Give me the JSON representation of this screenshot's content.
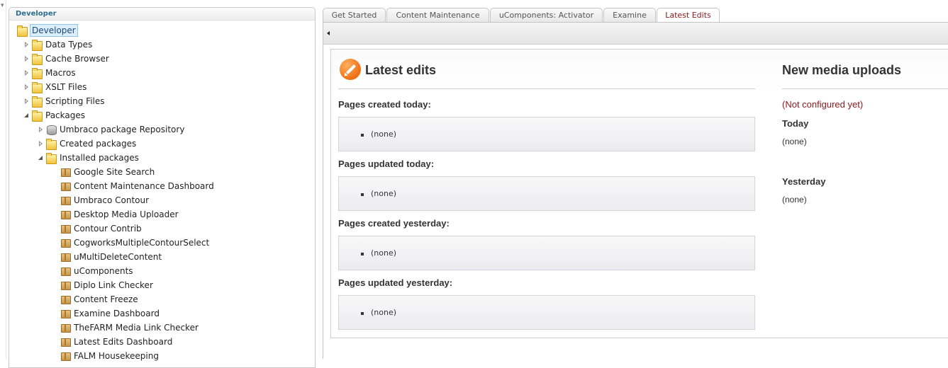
{
  "tree": {
    "header": "Developer",
    "items": [
      {
        "label": "Developer",
        "icon": "folder-icon",
        "selected": true
      },
      {
        "label": "Data Types",
        "icon": "folder-icon"
      },
      {
        "label": "Cache Browser",
        "icon": "folder-icon"
      },
      {
        "label": "Macros",
        "icon": "folder-icon"
      },
      {
        "label": "XSLT Files",
        "icon": "folder-icon"
      },
      {
        "label": "Scripting Files",
        "icon": "folder-icon"
      },
      {
        "label": "Packages",
        "icon": "folder-icon"
      },
      {
        "label": "Umbraco package Repository",
        "icon": "database-icon"
      },
      {
        "label": "Created packages",
        "icon": "folder-icon"
      },
      {
        "label": "Installed packages",
        "icon": "folder-icon"
      },
      {
        "label": "Google Site Search",
        "icon": "package-icon"
      },
      {
        "label": "Content Maintenance Dashboard",
        "icon": "package-icon"
      },
      {
        "label": "Umbraco Contour",
        "icon": "package-icon"
      },
      {
        "label": "Desktop Media Uploader",
        "icon": "package-icon"
      },
      {
        "label": "Contour Contrib",
        "icon": "package-icon"
      },
      {
        "label": "CogworksMultipleContourSelect",
        "icon": "package-icon"
      },
      {
        "label": "uMultiDeleteContent",
        "icon": "package-icon"
      },
      {
        "label": "uComponents",
        "icon": "package-icon"
      },
      {
        "label": "Diplo Link Checker",
        "icon": "package-icon"
      },
      {
        "label": "Content Freeze",
        "icon": "package-icon"
      },
      {
        "label": "Examine Dashboard",
        "icon": "package-icon"
      },
      {
        "label": "TheFARM Media Link Checker",
        "icon": "package-icon"
      },
      {
        "label": "Latest Edits Dashboard",
        "icon": "package-icon"
      },
      {
        "label": "FALM Housekeeping",
        "icon": "package-icon"
      }
    ]
  },
  "tabs": [
    {
      "label": "Get Started"
    },
    {
      "label": "Content Maintenance"
    },
    {
      "label": "uComponents: Activator"
    },
    {
      "label": "Examine"
    },
    {
      "label": "Latest Edits",
      "active": true
    }
  ],
  "latest_edits": {
    "title": "Latest edits",
    "sections": [
      {
        "label": "Pages created today:",
        "items": [
          "(none)"
        ]
      },
      {
        "label": "Pages updated today:",
        "items": [
          "(none)"
        ]
      },
      {
        "label": "Pages created yesterday:",
        "items": [
          "(none)"
        ]
      },
      {
        "label": "Pages updated yesterday:",
        "items": [
          "(none)"
        ]
      }
    ]
  },
  "media_uploads": {
    "title": "New media uploads",
    "note": "(Not configured yet)",
    "today_label": "Today",
    "today_value": "(none)",
    "yesterday_label": "Yesterday",
    "yesterday_value": "(none)"
  },
  "colors": {
    "active_tab_text": "#8b1a1a",
    "header_text": "#2c6e8e",
    "accent_icon": "#ef6f12"
  }
}
